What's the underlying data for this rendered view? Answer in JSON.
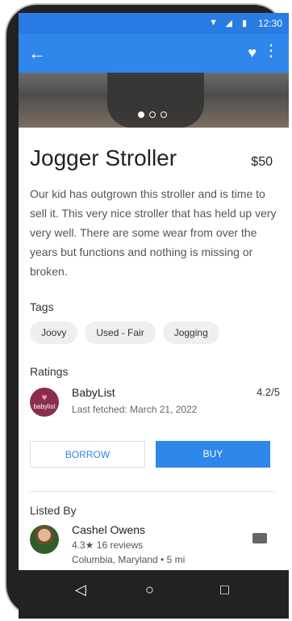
{
  "status": {
    "time": "12:30"
  },
  "appbar": {
    "back": "←",
    "favorite": "♥",
    "more": "⋮"
  },
  "product": {
    "title": "Jogger Stroller",
    "price": "$50",
    "description": "Our kid has outgrown this stroller and is time to sell it. This very nice stroller that has held up very very well. There are some wear from over the years but functions and nothing is missing or broken."
  },
  "tags": {
    "label": "Tags",
    "items": [
      "Joovy",
      "Used - Fair",
      "Jogging"
    ]
  },
  "ratings": {
    "label": "Ratings",
    "source": "BabyList",
    "logo_text": "babylist",
    "fetched": "Last fetched: March 21, 2022",
    "score": "4.2/5"
  },
  "actions": {
    "borrow": "BORROW",
    "buy": "BUY"
  },
  "listed_by": {
    "label": "Listed By",
    "name": "Cashel Owens",
    "reviews": "4.3★ 16 reviews",
    "location": "Columbia, Maryland • 5 mi"
  },
  "nav": {
    "back": "◁",
    "home": "○",
    "recent": "□"
  }
}
